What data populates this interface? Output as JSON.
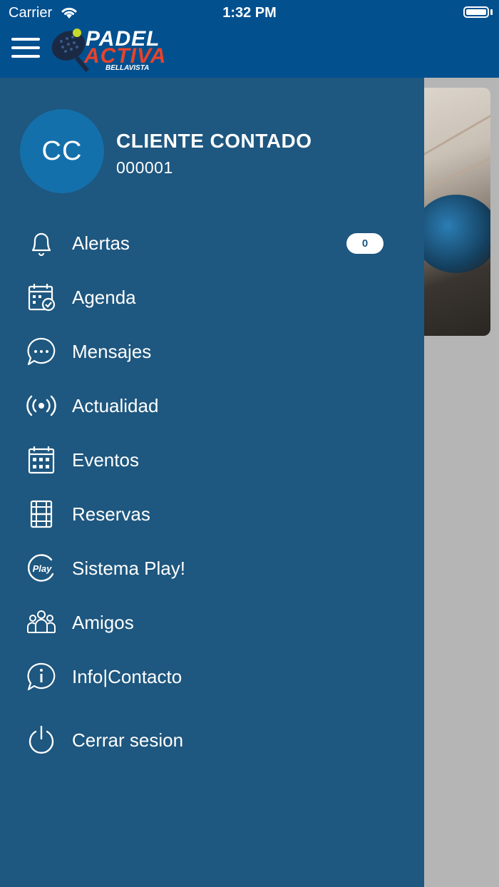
{
  "status_bar": {
    "carrier": "Carrier",
    "time": "1:32 PM"
  },
  "header": {
    "logo": {
      "line1": "PADEL",
      "line2": "ACTIVA",
      "line3": "BELLAVISTA"
    }
  },
  "user": {
    "initials": "CC",
    "name": "CLIENTE CONTADO",
    "id": "000001"
  },
  "menu": {
    "items": [
      {
        "label": "Alertas",
        "icon": "bell-icon",
        "badge": "0"
      },
      {
        "label": "Agenda",
        "icon": "calendar-check-icon"
      },
      {
        "label": "Mensajes",
        "icon": "chat-bubble-icon"
      },
      {
        "label": "Actualidad",
        "icon": "broadcast-icon"
      },
      {
        "label": "Eventos",
        "icon": "calendar-grid-icon"
      },
      {
        "label": "Reservas",
        "icon": "court-icon"
      },
      {
        "label": "Sistema Play!",
        "icon": "play-logo-icon"
      },
      {
        "label": "Amigos",
        "icon": "friends-icon"
      },
      {
        "label": "Info|Contacto",
        "icon": "info-bubble-icon"
      },
      {
        "label": "Cerrar sesion",
        "icon": "power-icon"
      }
    ]
  },
  "colors": {
    "header": "#03508f",
    "drawer": "#1e577f",
    "avatar": "#1470ab",
    "accent_red": "#e8432b"
  }
}
